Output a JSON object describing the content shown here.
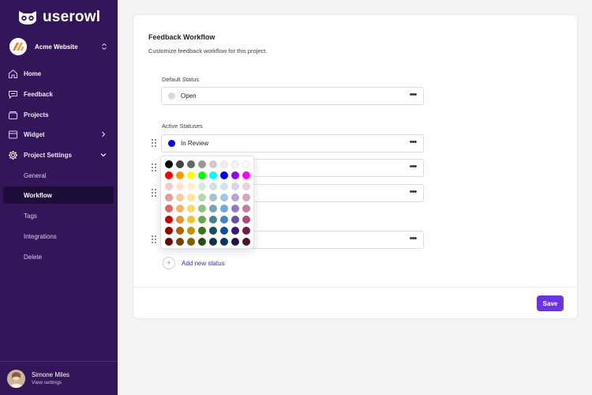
{
  "app": {
    "name": "userowl"
  },
  "project": {
    "name": "Acme Website"
  },
  "sidebar": {
    "items": [
      {
        "label": "Home",
        "icon": "home-icon"
      },
      {
        "label": "Feedback",
        "icon": "feedback-icon"
      },
      {
        "label": "Projects",
        "icon": "projects-icon"
      },
      {
        "label": "Widget",
        "icon": "widget-icon"
      },
      {
        "label": "Project Settings",
        "icon": "gear-icon"
      }
    ],
    "sub_items": [
      {
        "label": "General"
      },
      {
        "label": "Workflow"
      },
      {
        "label": "Tags"
      },
      {
        "label": "Integrations"
      },
      {
        "label": "Delete"
      }
    ],
    "active_sub_item": "Workflow"
  },
  "user": {
    "name": "Simone Miles",
    "link": "View settings"
  },
  "main": {
    "title": "Feedback Workflow",
    "subtitle": "Customize feedback workflow for this project.",
    "default_status_label": "Default Status",
    "default_status": {
      "label": "Open",
      "color": "#d9d9d9"
    },
    "active_statuses_label": "Active Statuses",
    "active_statuses": [
      {
        "label": "In Review",
        "color": "#0000ff"
      }
    ],
    "add_status_label": "Add new status",
    "save_label": "Save"
  },
  "color_picker": {
    "colors": [
      "#000000",
      "#434343",
      "#666666",
      "#999999",
      "#cccccc",
      "#efefef",
      "#f3f3f3",
      "#ffffff",
      "#ff0000",
      "#ff9900",
      "#ffff00",
      "#00ff00",
      "#00ffff",
      "#0000ff",
      "#9900ff",
      "#ff00ff",
      "#f4cccc",
      "#fce5cd",
      "#fff2cc",
      "#d9ead3",
      "#d0e0e3",
      "#cfe2f3",
      "#d9d2e9",
      "#ead1dc",
      "#ea9999",
      "#f9cb9c",
      "#ffe599",
      "#b6d7a8",
      "#a2c4c9",
      "#9fc5e8",
      "#b4a7d6",
      "#d5a6bd",
      "#e06666",
      "#f6b26b",
      "#ffd966",
      "#93c47d",
      "#76a5af",
      "#6fa8dc",
      "#8e7cc3",
      "#c27ba0",
      "#cc0000",
      "#e69138",
      "#f1c232",
      "#6aa84f",
      "#45818e",
      "#3d85c6",
      "#674ea7",
      "#a64d79",
      "#990000",
      "#b45f06",
      "#bf9000",
      "#38761d",
      "#134f5c",
      "#0b5394",
      "#351c75",
      "#741b47",
      "#660000",
      "#783f04",
      "#7f6000",
      "#274e13",
      "#0c343d",
      "#073763",
      "#20124d",
      "#4c1130"
    ]
  }
}
